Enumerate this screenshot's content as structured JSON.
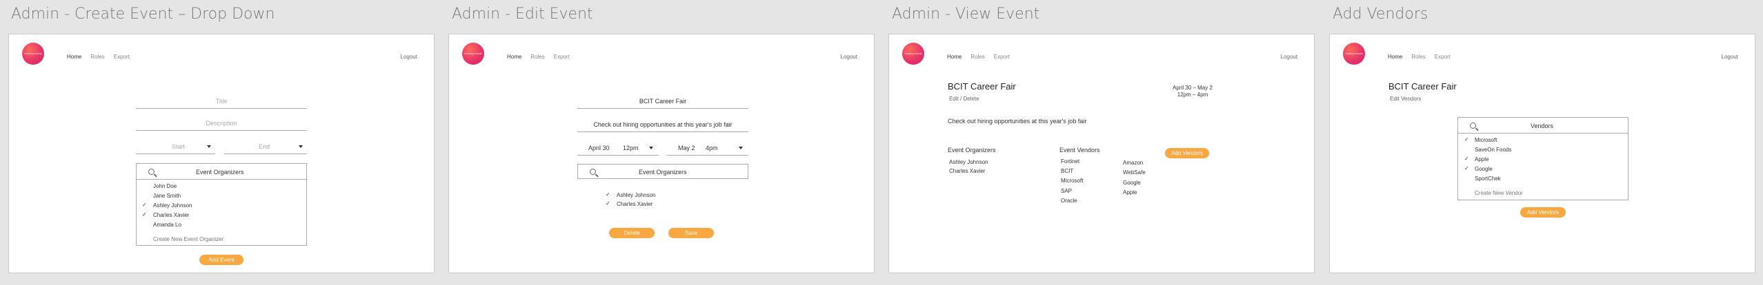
{
  "frames": [
    {
      "title": "Admin - Create Event – Drop Down",
      "nav": [
        "Home",
        "Roles",
        "Export"
      ],
      "logout": "Logout",
      "logo_text": "Helping Hands",
      "title_placeholder": "Title",
      "description_placeholder": "Description",
      "start_placeholder": "Start",
      "end_placeholder": "End",
      "search_placeholder": "Event Organizers",
      "organizers": [
        {
          "name": "John Doe",
          "checked": false
        },
        {
          "name": "Jane Smith",
          "checked": false
        },
        {
          "name": "Ashley Johnson",
          "checked": true
        },
        {
          "name": "Charles Xavier",
          "checked": true
        },
        {
          "name": "Amanda Lo",
          "checked": false
        }
      ],
      "create_new": "Create New Event Organizer",
      "add_button": "Add Event"
    },
    {
      "title": "Admin - Edit Event",
      "nav": [
        "Home",
        "Roles",
        "Export"
      ],
      "logout": "Logout",
      "logo_text": "Helping Hands",
      "event_title": "BCIT Career Fair",
      "description": "Check out hiring opportunities at this year's job fair",
      "start_date": "April 30",
      "start_time": "12pm",
      "end_date": "May 2",
      "end_time": "4pm",
      "search_placeholder": "Event Organizers",
      "organizers": [
        "Ashley Johnson",
        "Charles Xavier"
      ],
      "delete_button": "Delete",
      "save_button": "Save"
    },
    {
      "title": "Admin - View Event",
      "nav": [
        "Home",
        "Roles",
        "Export"
      ],
      "logout": "Logout",
      "logo_text": "Helping Hands",
      "event_title": "BCIT Career Fair",
      "actions": "Edit / Delete",
      "date_range": "April 30 – May 2",
      "time_range": "12pm – 4pm",
      "description": "Check out hiring opportunities at this year's job fair",
      "organizers_heading": "Event Organizers",
      "organizers": [
        "Ashley Johnson",
        "Charles Xavier"
      ],
      "vendors_heading": "Event Vendors",
      "vendors_col1": [
        "Fortinet",
        "BCIT",
        "Microsoft",
        "SAP",
        "Oracle"
      ],
      "vendors_col2": [
        "Amazon",
        "WebSafe",
        "Google",
        "Apple"
      ],
      "add_vendors_button": "Add Vendors"
    },
    {
      "title": "Add Vendors",
      "nav": [
        "Home",
        "Roles",
        "Export"
      ],
      "logout": "Logout",
      "logo_text": "Helping Hands",
      "event_title": "BCIT Career Fair",
      "edit_vendors": "Edit Vendors",
      "search_placeholder": "Vendors",
      "vendors": [
        {
          "name": "Microsoft",
          "checked": true
        },
        {
          "name": "SaveOn Foods",
          "checked": false
        },
        {
          "name": "Apple",
          "checked": true
        },
        {
          "name": "Google",
          "checked": true
        },
        {
          "name": "SportChek",
          "checked": false
        }
      ],
      "create_new": "Create New Vendor",
      "add_button": "Add Vendors"
    }
  ]
}
